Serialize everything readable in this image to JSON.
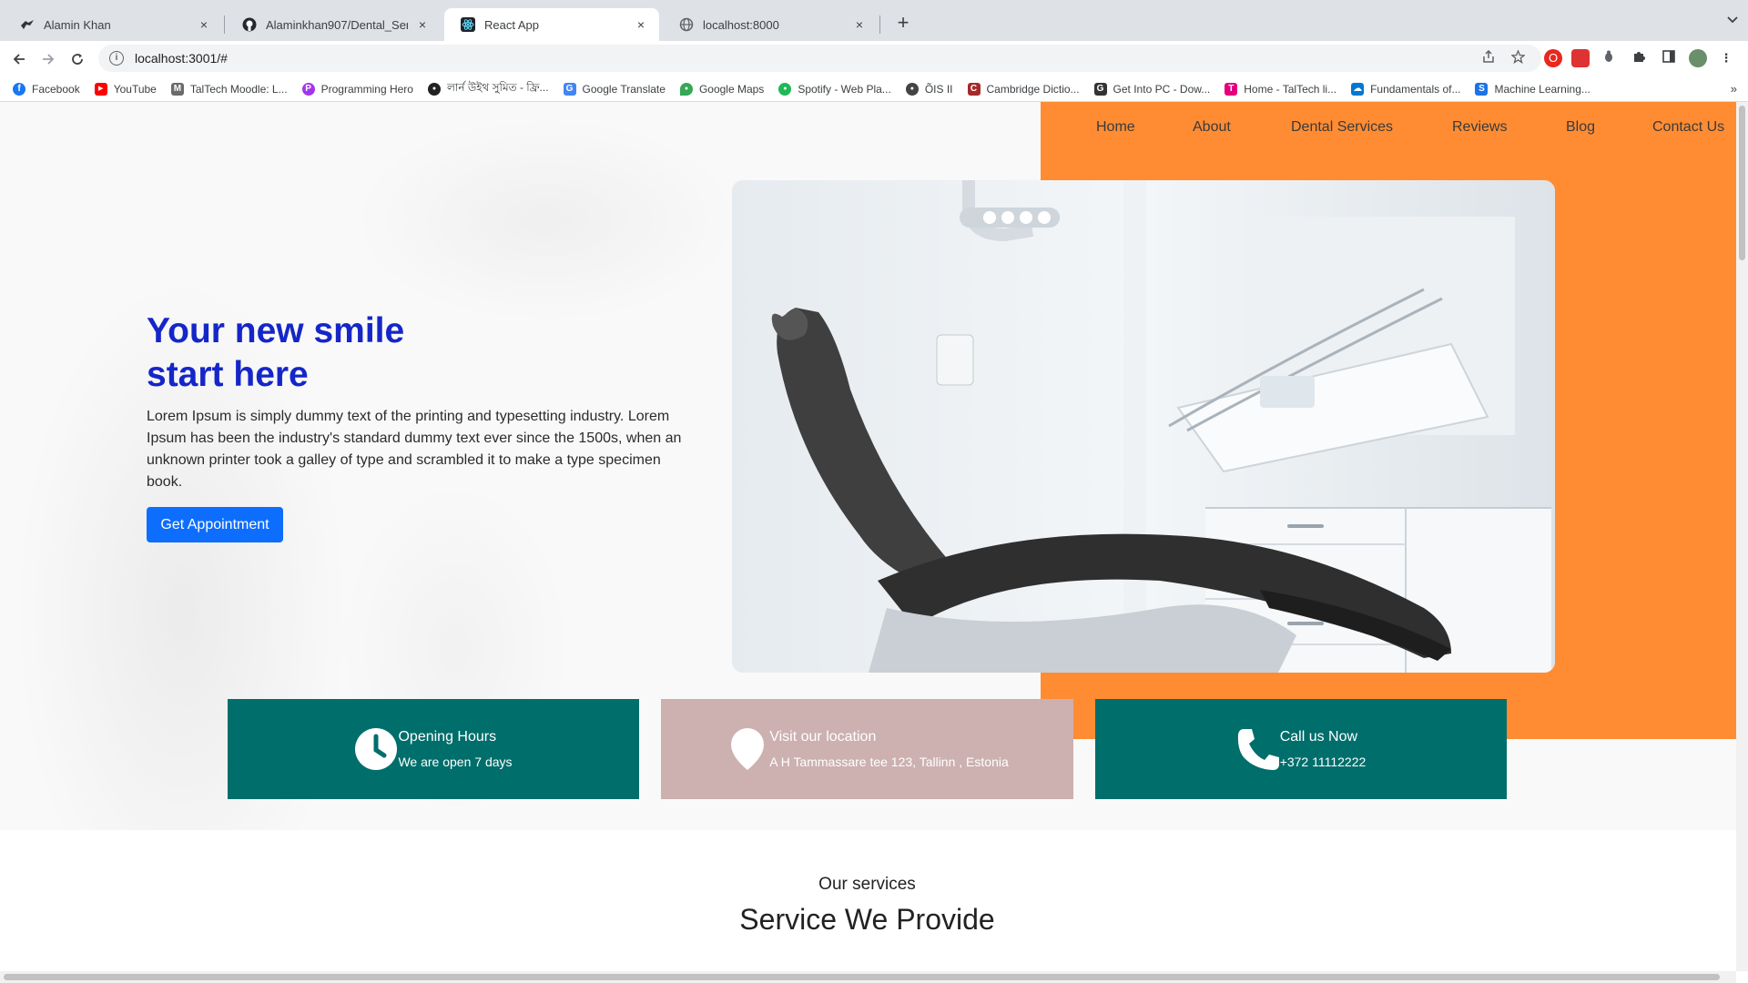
{
  "browser": {
    "tabs": [
      {
        "title": "Alamin Khan",
        "favicon": "bird-icon",
        "active": false
      },
      {
        "title": "Alaminkhan907/Dental_Services",
        "favicon": "github-icon",
        "active": false
      },
      {
        "title": "React App",
        "favicon": "react-icon",
        "active": true
      },
      {
        "title": "localhost:8000",
        "favicon": "globe-icon",
        "active": false
      }
    ],
    "close_glyph": "×",
    "new_tab_glyph": "+",
    "url": "localhost:3001/#",
    "bookmarks": [
      {
        "label": "Facebook",
        "color": "#1877f2",
        "glyph": "f"
      },
      {
        "label": "YouTube",
        "color": "#ff0000",
        "glyph": "▶"
      },
      {
        "label": "TalTech Moodle: L...",
        "color": "#6b6b6b",
        "glyph": "M"
      },
      {
        "label": "Programming Hero",
        "color": "#a335ee",
        "glyph": "P"
      },
      {
        "label": "লার্ন উইথ সুমিত - ফ্রি...",
        "color": "#222222",
        "glyph": "●"
      },
      {
        "label": "Google Translate",
        "color": "#4285f4",
        "glyph": "G"
      },
      {
        "label": "Google Maps",
        "color": "#34a853",
        "glyph": "●"
      },
      {
        "label": "Spotify - Web Pla...",
        "color": "#1db954",
        "glyph": "●"
      },
      {
        "label": "ÕIS II",
        "color": "#444444",
        "glyph": "●"
      },
      {
        "label": "Cambridge Dictio...",
        "color": "#a52a2a",
        "glyph": "C"
      },
      {
        "label": "Get Into PC - Dow...",
        "color": "#333333",
        "glyph": "G"
      },
      {
        "label": "Home - TalTech li...",
        "color": "#e4007c",
        "glyph": "T"
      },
      {
        "label": "Fundamentals of...",
        "color": "#0078d4",
        "glyph": "☁"
      },
      {
        "label": "Machine Learning...",
        "color": "#1a73e8",
        "glyph": "S"
      }
    ],
    "bookmarks_more": "»"
  },
  "nav": {
    "items": [
      "Home",
      "About",
      "Dental Services",
      "Reviews",
      "Blog",
      "Contact Us"
    ]
  },
  "hero": {
    "title_line1": "Your new smile",
    "title_line2": "start here",
    "text": "Lorem Ipsum is simply dummy text of the printing and typesetting industry. Lorem Ipsum has been the industry's standard dummy text ever since the 1500s, when an unknown printer took a galley of type and scrambled it to make a type specimen book.",
    "cta_label": "Get Appointment"
  },
  "cards": [
    {
      "heading": "Opening Hours",
      "sub": "We are open 7 days",
      "icon": "clock-icon",
      "color": "#006e6b"
    },
    {
      "heading": "Visit our location",
      "sub": "A H Tammassare tee 123, Tallinn , Estonia",
      "icon": "location-pin-icon",
      "color": "#cdb0b0"
    },
    {
      "heading": "Call us Now",
      "sub": "+372 11112222",
      "icon": "phone-icon",
      "color": "#006e6b"
    }
  ],
  "services": {
    "subtitle": "Our services",
    "title": "Service We Provide"
  },
  "colors": {
    "accent_orange": "#ff8c33",
    "hero_title": "#1526c8",
    "button_blue": "#0d6efd",
    "teal": "#006e6b",
    "dusty_pink": "#cdb0b0"
  }
}
